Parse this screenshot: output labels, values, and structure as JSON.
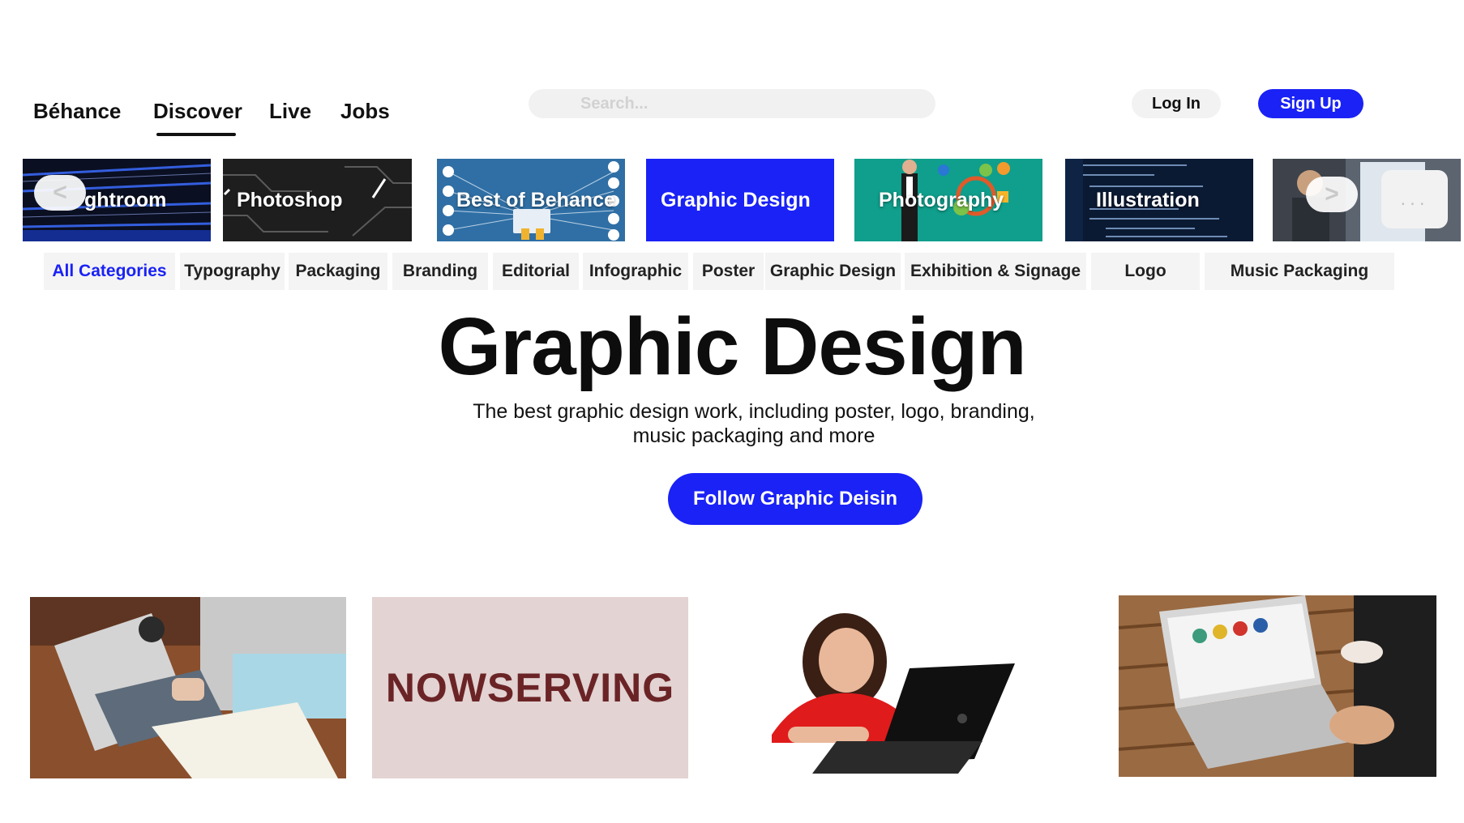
{
  "nav": {
    "brand": "Béhance",
    "links": [
      "Discover",
      "Live",
      "Jobs"
    ]
  },
  "search": {
    "placeholder": "Search..."
  },
  "auth": {
    "login": "Log In",
    "signup": "Sign Up"
  },
  "carousel": {
    "prev": "<",
    "next": ">",
    "more": "...",
    "tiles": [
      "ghtroom",
      "Photoshop",
      "Best of Behance",
      "Graphic Design",
      "Photography",
      "Illustration"
    ]
  },
  "subcategories": {
    "items": [
      "All Categories",
      "Typography",
      "Packaging",
      "Branding",
      "Editorial",
      "Infographic",
      "Poster",
      "Graphic Design",
      "Exhibition & Signage",
      "Logo",
      "Music Packaging"
    ]
  },
  "hero": {
    "title": "Graphic Design",
    "description_line1": "The best graphic design work, including poster, logo, branding,",
    "description_line2": "music packaging and more",
    "follow": "Follow Graphic Deisin"
  },
  "projects": {
    "nowserving": "NOWSERVING"
  },
  "colors": {
    "accent": "#1a22f5",
    "graphic_design_tile": "#1a22f5",
    "photography_tile": "#0f9f8c",
    "best_of_behance_tile": "#2f6fa5",
    "nowserving_bg": "#e3d3d3",
    "nowserving_text": "#6b2426"
  }
}
